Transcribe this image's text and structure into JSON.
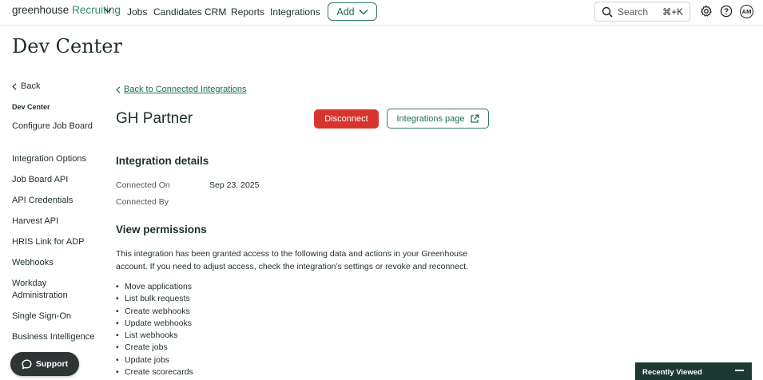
{
  "app": {
    "logo_main": "greenhouse",
    "logo_sub": "Recruiting"
  },
  "nav": {
    "links": [
      "Jobs",
      "Candidates",
      "CRM",
      "Reports",
      "Integrations"
    ],
    "add_label": "Add",
    "search_placeholder": "Search",
    "search_shortcut": "⌘+K",
    "avatar_initials": "AM"
  },
  "page": {
    "title": "Dev Center"
  },
  "sidebar": {
    "back_label": "Back",
    "heading": "Dev Center",
    "items": [
      "Configure Job Board",
      "Integration Options",
      "Job Board API",
      "API Credentials",
      "Harvest API",
      "HRIS Link for ADP",
      "Webhooks",
      "Workday Administration",
      "Single Sign-On",
      "Business Intelligence"
    ]
  },
  "main": {
    "back_link": "Back to Connected Integrations",
    "partner_name": "GH Partner",
    "disconnect_label": "Disconnect",
    "integrations_page_label": "Integrations page",
    "details": {
      "title": "Integration details",
      "connected_on_label": "Connected On",
      "connected_on_value": "Sep 23, 2025",
      "connected_by_label": "Connected By"
    },
    "permissions": {
      "title": "View permissions",
      "description": "This integration has been granted access to the following data and actions in your Greenhouse account. If you need to adjust access, check the integration’s settings or revoke and reconnect.",
      "items": [
        "Move applications",
        "List bulk requests",
        "Create webhooks",
        "Update webhooks",
        "List webhooks",
        "Create jobs",
        "Update jobs",
        "Create scorecards"
      ]
    }
  },
  "support_label": "Support",
  "recently_viewed_label": "Recently Viewed",
  "colors": {
    "brand_green": "#2b7a66",
    "danger_red": "#d7352f",
    "dark_panel": "#1c3a33"
  }
}
